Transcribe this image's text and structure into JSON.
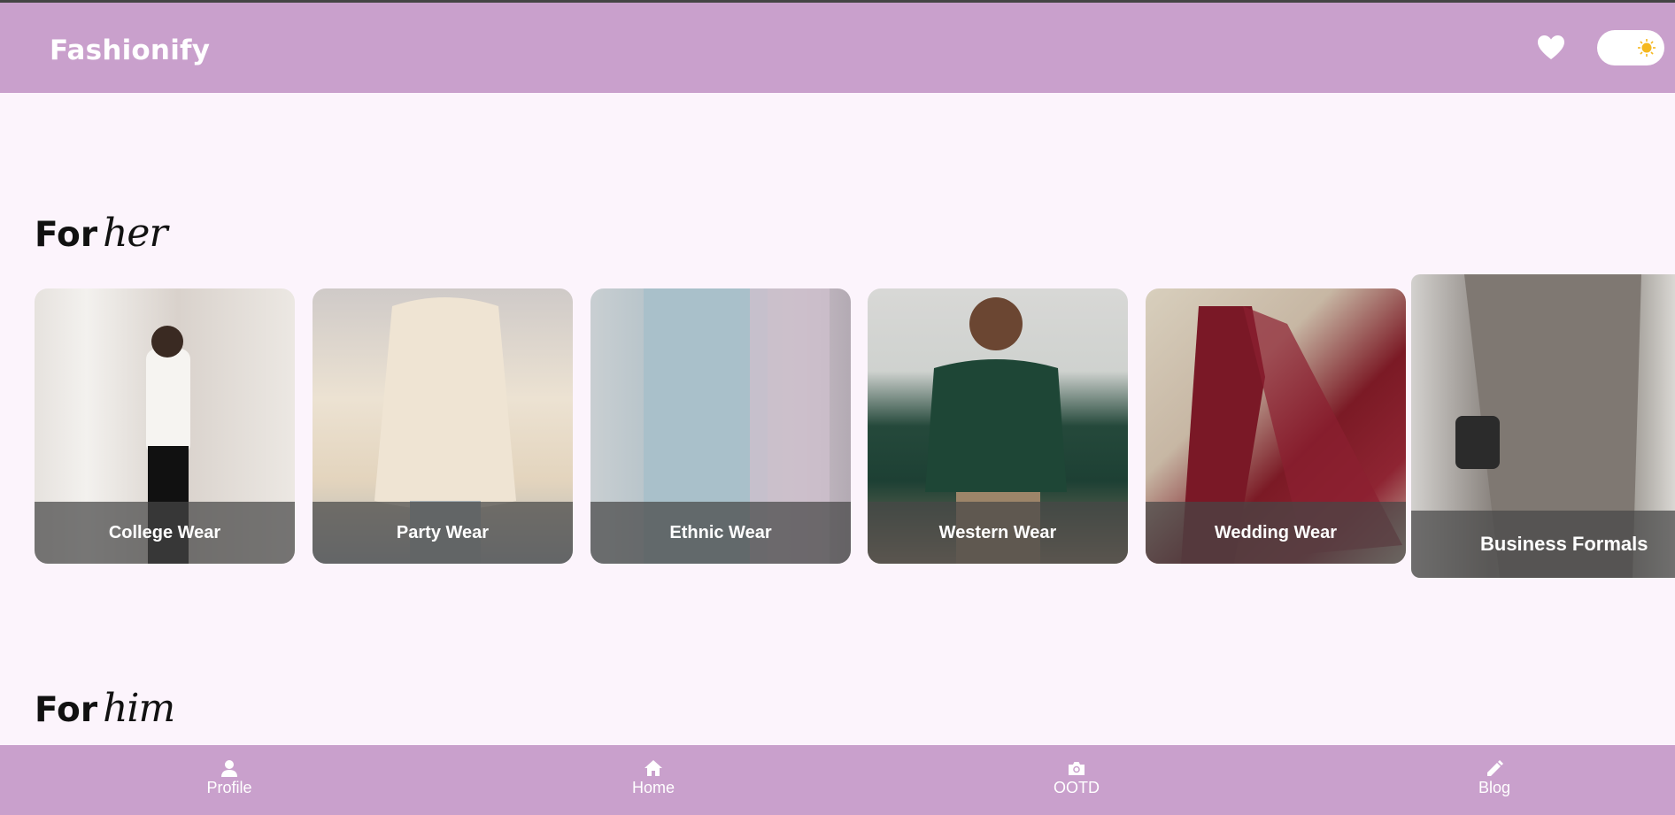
{
  "header": {
    "brand": "Fashionify",
    "favorites_icon": "heart-icon",
    "theme_toggle_icon": "sun-icon"
  },
  "sections": [
    {
      "prefix": "For",
      "script": "her"
    },
    {
      "prefix": "For",
      "script": "him"
    }
  ],
  "categories_her": [
    {
      "label": "College Wear"
    },
    {
      "label": "Party Wear"
    },
    {
      "label": "Ethnic Wear"
    },
    {
      "label": "Western Wear"
    },
    {
      "label": "Wedding Wear"
    },
    {
      "label": "Business Formals"
    }
  ],
  "bottom_nav": [
    {
      "label": "Profile",
      "icon": "user-icon"
    },
    {
      "label": "Home",
      "icon": "home-icon"
    },
    {
      "label": "OOTD",
      "icon": "camera-icon"
    },
    {
      "label": "Blog",
      "icon": "pencil-icon"
    }
  ],
  "colors": {
    "primary": "#c9a0cc",
    "background": "#fcf4fc",
    "sun": "#f5b820"
  }
}
